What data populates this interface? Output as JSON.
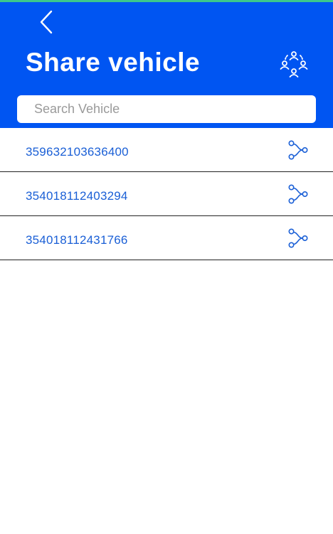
{
  "colors": {
    "header_bg": "#0055f2",
    "top_strip": "#3cc88c",
    "accent_text": "#1a5fd6"
  },
  "header": {
    "title": "Share vehicle",
    "back_icon": "chevron-left-icon",
    "action_icon": "group-users-icon"
  },
  "search": {
    "placeholder": "Search Vehicle",
    "value": ""
  },
  "vehicles": [
    {
      "id": "359632103636400",
      "action_icon": "share-icon"
    },
    {
      "id": "354018112403294",
      "action_icon": "share-icon"
    },
    {
      "id": "354018112431766",
      "action_icon": "share-icon"
    }
  ]
}
